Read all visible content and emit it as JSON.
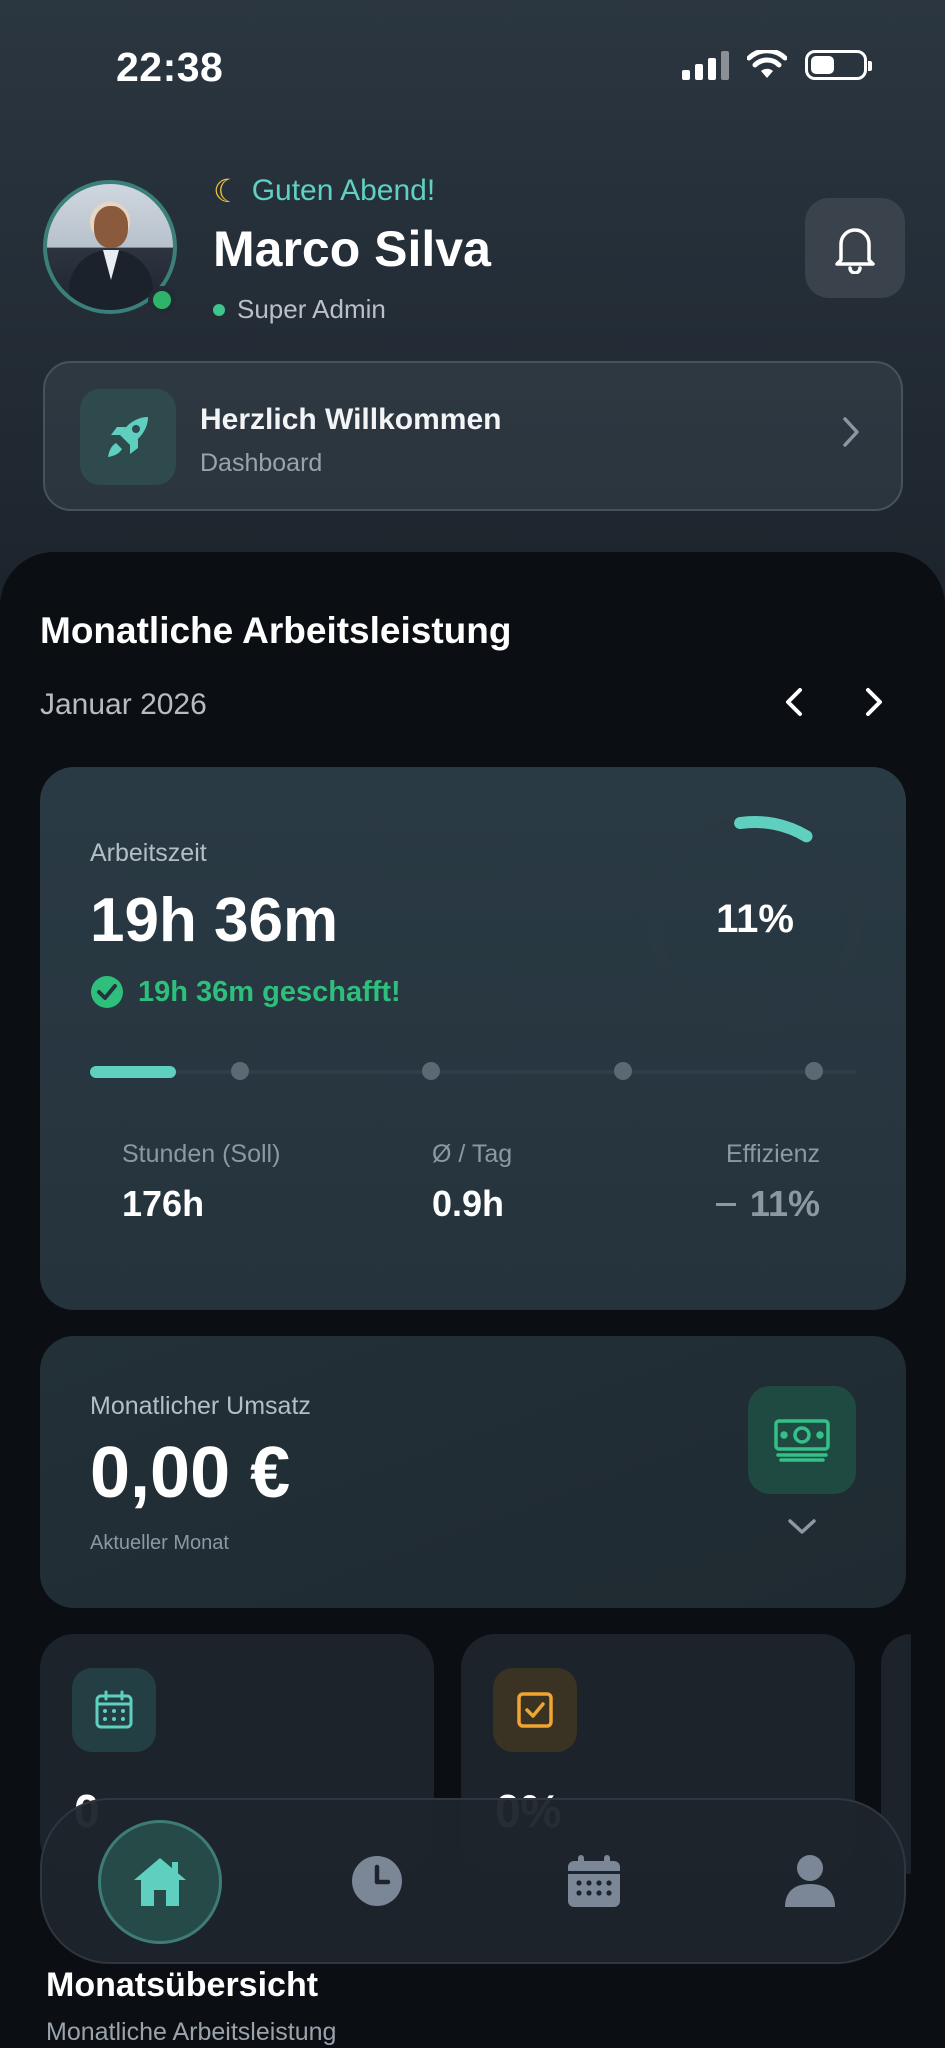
{
  "status_bar": {
    "time": "22:38"
  },
  "header": {
    "greeting_icon": "moon-emoji",
    "greeting": "Guten Abend!",
    "name": "Marco Silva",
    "role": "Super Admin",
    "status": "online"
  },
  "welcome": {
    "title": "Herzlich Willkommen",
    "subtitle": "Dashboard",
    "icon": "rocket-icon"
  },
  "performance": {
    "section_title": "Monatliche Arbeitsleistung",
    "month": "Januar 2026"
  },
  "work_card": {
    "label": "Arbeitszeit",
    "value": "19h 36m",
    "done_text": "19h 36m geschafft!",
    "progress_percent_label": "11%",
    "progress_fraction": 0.11,
    "stats": [
      {
        "label": "Stunden (Soll)",
        "value": "176h"
      },
      {
        "label": "Ø / Tag",
        "value": "0.9h"
      },
      {
        "label": "Effizienz",
        "value": "11%"
      }
    ]
  },
  "revenue_card": {
    "label": "Monatlicher Umsatz",
    "value": "0,00 €",
    "subtitle": "Aktueller Monat"
  },
  "mini_cards": [
    {
      "icon": "calendar-icon",
      "value": "0"
    },
    {
      "icon": "check-square-icon",
      "value": "0%"
    }
  ],
  "bottom_nav": {
    "items": [
      {
        "icon": "home-icon",
        "active": true
      },
      {
        "icon": "clock-icon",
        "active": false
      },
      {
        "icon": "calendar-icon",
        "active": false
      },
      {
        "icon": "user-icon",
        "active": false
      }
    ]
  },
  "footer": {
    "title": "Monatsübersicht",
    "subtitle": "Monatliche Arbeitsleistung"
  },
  "colors": {
    "accent_teal": "#5fcfc0",
    "success_green": "#2fbf7c",
    "warning_amber": "#f0a531"
  }
}
